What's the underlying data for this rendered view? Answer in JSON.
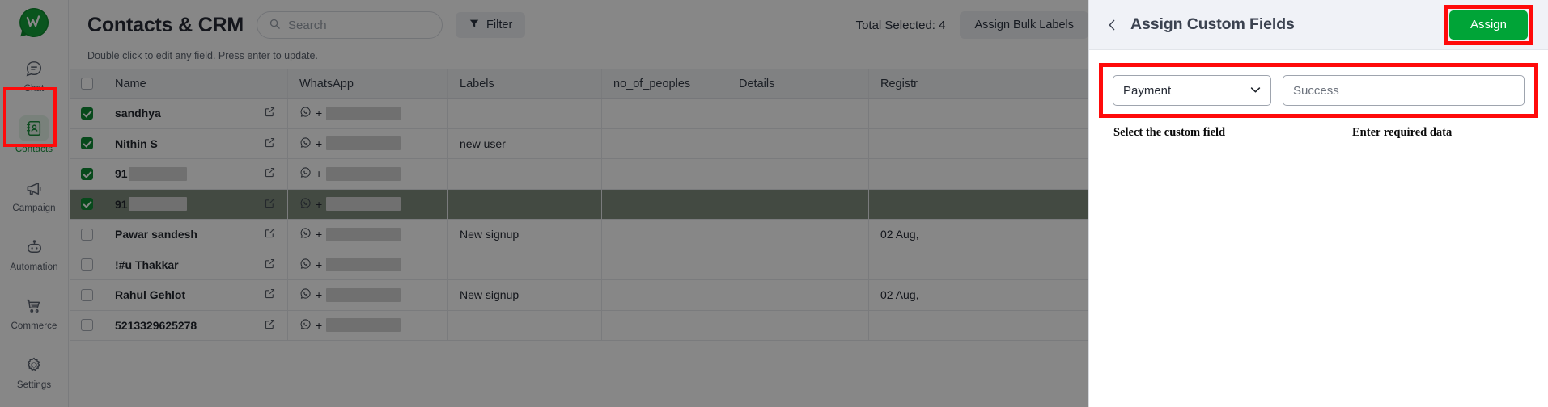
{
  "sidebar": {
    "logo_name": "whatsapp-w-logo",
    "items": [
      {
        "label": "Chat",
        "icon": "chat-bubble-icon",
        "active": false
      },
      {
        "label": "Contacts",
        "icon": "contacts-book-icon",
        "active": true
      },
      {
        "label": "Campaign",
        "icon": "megaphone-icon",
        "active": false
      },
      {
        "label": "Automation",
        "icon": "robot-icon",
        "active": false
      },
      {
        "label": "Commerce",
        "icon": "shopping-cart-icon",
        "active": false
      },
      {
        "label": "Settings",
        "icon": "gear-icon",
        "active": false
      }
    ]
  },
  "header": {
    "title": "Contacts & CRM",
    "subtitle": "Double click to edit any field. Press enter to update.",
    "search_placeholder": "Search",
    "search_value": "",
    "filter_label": "Filter",
    "total_selected": "Total Selected: 4",
    "bulk_labels_button": "Assign Bulk Labels"
  },
  "table": {
    "columns": [
      "Name",
      "WhatsApp",
      "Labels",
      "no_of_peoples",
      "Details",
      "Registr"
    ],
    "header_checkbox_checked": false,
    "rows": [
      {
        "checked": true,
        "name": "sandhya",
        "name_redacted": false,
        "whatsapp": "+",
        "labels": "",
        "no_of_peoples": "",
        "details": "",
        "registered": "",
        "highlight": false
      },
      {
        "checked": true,
        "name": "Nithin S",
        "name_redacted": false,
        "whatsapp": "+",
        "labels": "new user",
        "no_of_peoples": "",
        "details": "",
        "registered": "",
        "highlight": false
      },
      {
        "checked": true,
        "name": "91",
        "name_redacted": true,
        "whatsapp": "+",
        "labels": "",
        "no_of_peoples": "",
        "details": "",
        "registered": "",
        "highlight": false
      },
      {
        "checked": true,
        "name": "91",
        "name_redacted": true,
        "whatsapp": "+",
        "labels": "",
        "no_of_peoples": "",
        "details": "",
        "registered": "",
        "highlight": true
      },
      {
        "checked": false,
        "name": "Pawar sandesh",
        "name_redacted": false,
        "whatsapp": "+",
        "labels": "New signup",
        "no_of_peoples": "",
        "details": "",
        "registered": "02 Aug,",
        "highlight": false
      },
      {
        "checked": false,
        "name": "!#u Thakkar",
        "name_redacted": false,
        "whatsapp": "+",
        "labels": "",
        "no_of_peoples": "",
        "details": "",
        "registered": "",
        "highlight": false
      },
      {
        "checked": false,
        "name": "Rahul Gehlot",
        "name_redacted": false,
        "whatsapp": "+",
        "labels": "New signup",
        "no_of_peoples": "",
        "details": "",
        "registered": "02 Aug,",
        "highlight": false
      },
      {
        "checked": false,
        "name": "5213329625278",
        "name_redacted": false,
        "whatsapp": "+",
        "labels": "",
        "no_of_peoples": "",
        "details": "",
        "registered": "",
        "highlight": false
      }
    ]
  },
  "panel": {
    "back_icon": "chevron-left-icon",
    "title": "Assign Custom Fields",
    "assign_button": "Assign",
    "custom_field_selected": "Payment",
    "chevron": "chevron-down-icon",
    "value_placeholder": "Success",
    "value_text": "Success",
    "annotation_left": "Select the custom field",
    "annotation_right": "Enter required data"
  },
  "colors": {
    "brand_green": "#00a437",
    "checkbox_green": "#0e8b33",
    "highlight_red": "#ff0a0a",
    "panel_header_bg": "#f0f2f7",
    "selected_row": "#7f8c7e"
  }
}
